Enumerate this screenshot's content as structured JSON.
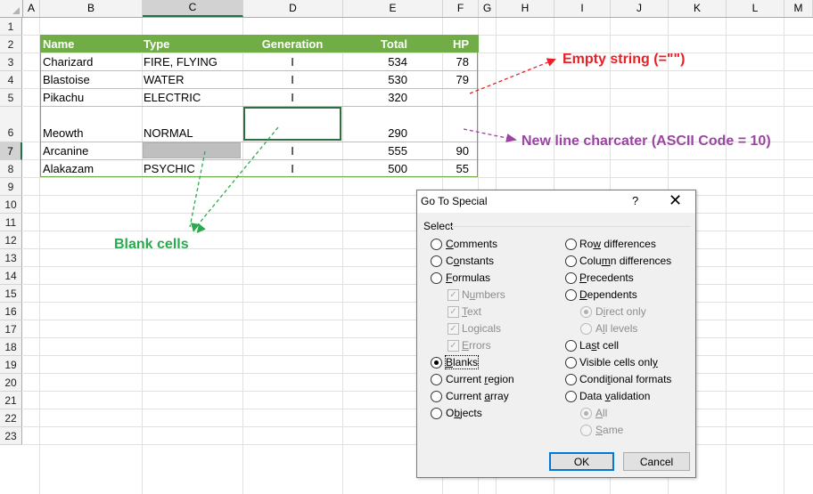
{
  "sheet": {
    "columns": [
      "A",
      "B",
      "C",
      "D",
      "E",
      "F",
      "G",
      "H",
      "I",
      "J",
      "K",
      "L",
      "M"
    ],
    "selected_column": "C",
    "rows": [
      "1",
      "2",
      "3",
      "4",
      "5",
      "6",
      "7",
      "8",
      "9",
      "10",
      "11",
      "12",
      "13",
      "14",
      "15",
      "16",
      "17",
      "18",
      "19",
      "20",
      "21",
      "22",
      "23"
    ],
    "selected_row": "7",
    "table": {
      "headers": [
        "Name",
        "Type",
        "Generation",
        "Total",
        "HP"
      ],
      "rows": [
        [
          "Charizard",
          "FIRE, FLYING",
          "I",
          "534",
          "78"
        ],
        [
          "Blastoise",
          "WATER",
          "I",
          "530",
          "79"
        ],
        [
          "Pikachu",
          "ELECTRIC",
          "I",
          "320",
          ""
        ],
        [
          "Meowth",
          "NORMAL",
          "",
          "290",
          ""
        ],
        [
          "Arcanine",
          "",
          "I",
          "555",
          "90"
        ],
        [
          "Alakazam",
          "PSYCHIC",
          "I",
          "500",
          "55"
        ]
      ]
    }
  },
  "annotations": {
    "empty_string": "Empty string (=\"\")",
    "new_line": "New line charcater (ASCII Code = 10)",
    "blank_cells": "Blank cells",
    "colors": {
      "red": "#ea1f26",
      "purple": "#9b45a3",
      "green": "#2aaa4f"
    }
  },
  "dialog": {
    "title": "Go To Special",
    "help": "?",
    "close": "✕",
    "group_label": "Select",
    "left_options": [
      {
        "pre": "",
        "u": "C",
        "post": "omments",
        "checked": false
      },
      {
        "pre": "C",
        "u": "o",
        "post": "nstants",
        "checked": false
      },
      {
        "pre": "",
        "u": "F",
        "post": "ormulas",
        "checked": false
      }
    ],
    "formula_subs": [
      {
        "pre": "N",
        "u": "u",
        "post": "mbers"
      },
      {
        "pre": "",
        "u": "T",
        "post": "ext"
      },
      {
        "pre": "Lo",
        "u": "g",
        "post": "icals"
      },
      {
        "pre": "",
        "u": "E",
        "post": "rrors"
      }
    ],
    "left_options_2": [
      {
        "pre": "",
        "u": "B",
        "post": "lanks",
        "checked": true
      },
      {
        "pre": "Current ",
        "u": "r",
        "post": "egion",
        "checked": false
      },
      {
        "pre": "Current ",
        "u": "a",
        "post": "rray",
        "checked": false
      },
      {
        "pre": "O",
        "u": "b",
        "post": "jects",
        "checked": false
      }
    ],
    "right_options": [
      {
        "pre": "Ro",
        "u": "w",
        "post": " differences"
      },
      {
        "pre": "Colu",
        "u": "m",
        "post": "n differences"
      },
      {
        "pre": "",
        "u": "P",
        "post": "recedents"
      },
      {
        "pre": "",
        "u": "D",
        "post": "ependents"
      }
    ],
    "dependent_subs": [
      {
        "pre": "D",
        "u": "i",
        "post": "rect only",
        "checked": true
      },
      {
        "pre": "A",
        "u": "l",
        "post": "l levels",
        "checked": false
      }
    ],
    "right_options_2": [
      {
        "pre": "La",
        "u": "s",
        "post": "t cell"
      },
      {
        "pre": "Visible cells onl",
        "u": "y",
        "post": ""
      },
      {
        "pre": "Condi",
        "u": "t",
        "post": "ional formats"
      },
      {
        "pre": "Data ",
        "u": "v",
        "post": "alidation"
      }
    ],
    "validation_subs": [
      {
        "pre": "",
        "u": "A",
        "post": "ll",
        "checked": true
      },
      {
        "pre": "",
        "u": "S",
        "post": "ame",
        "checked": false
      }
    ],
    "ok_label": "OK",
    "cancel_label": "Cancel"
  }
}
